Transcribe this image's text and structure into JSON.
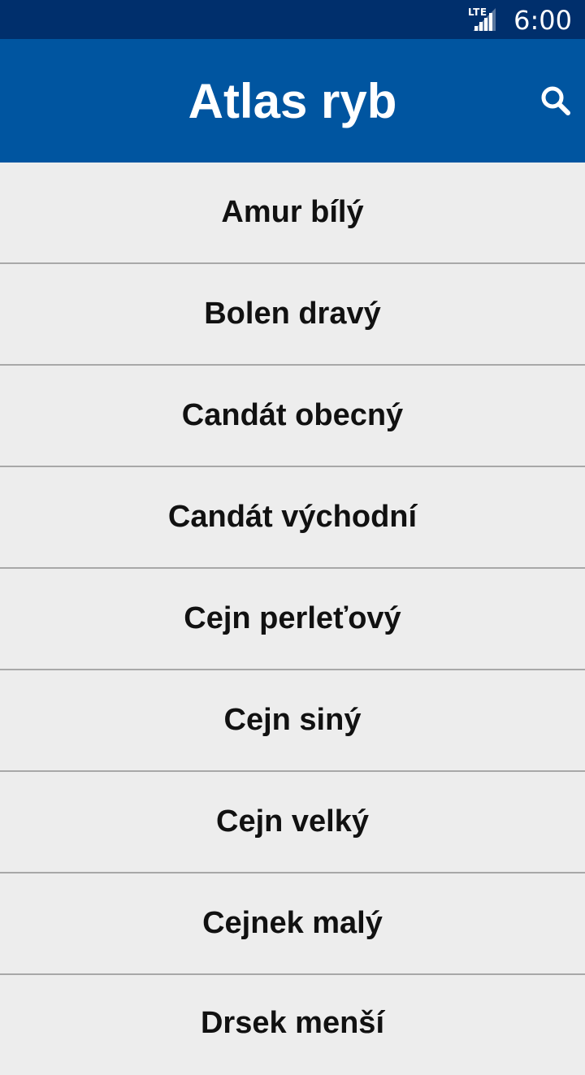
{
  "status_bar": {
    "network": "LTE",
    "time": "6:00",
    "icons": [
      "signal-icon"
    ]
  },
  "app_bar": {
    "title": "Atlas ryb",
    "search_icon": "search-icon"
  },
  "fish_list": [
    "Amur bílý",
    "Bolen dravý",
    "Candát obecný",
    "Candát východní",
    "Cejn perleťový",
    "Cejn siný",
    "Cejn velký",
    "Cejnek malý",
    "Drsek menší"
  ],
  "colors": {
    "status_bar": "#002f6c",
    "app_bar": "#0055a0",
    "list_background": "#ededed",
    "divider": "#a8a8a8"
  }
}
